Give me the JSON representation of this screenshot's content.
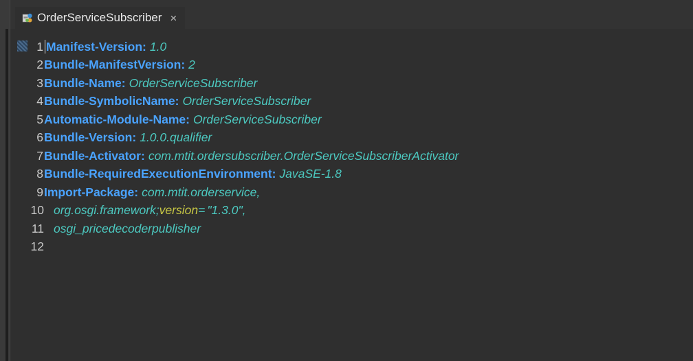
{
  "tab": {
    "title": "OrderServiceSubscriber",
    "close_glyph": "×",
    "icon": "manifest-file-icon"
  },
  "editor": {
    "lines": [
      {
        "num": "1",
        "key": "Manifest-Version",
        "value": "1.0"
      },
      {
        "num": "2",
        "key": "Bundle-ManifestVersion",
        "value": "2"
      },
      {
        "num": "3",
        "key": "Bundle-Name",
        "value": "OrderServiceSubscriber"
      },
      {
        "num": "4",
        "key": "Bundle-SymbolicName",
        "value": "OrderServiceSubscriber"
      },
      {
        "num": "5",
        "key": "Automatic-Module-Name",
        "value": "OrderServiceSubscriber"
      },
      {
        "num": "6",
        "key": "Bundle-Version",
        "value": "1.0.0.qualifier"
      },
      {
        "num": "7",
        "key": "Bundle-Activator",
        "value": "com.mtit.ordersubscriber.OrderServiceSubscriberActivator"
      },
      {
        "num": "8",
        "key": "Bundle-RequiredExecutionEnvironment",
        "value": "JavaSE-1.8"
      },
      {
        "num": "9",
        "key": "Import-Package",
        "value": "com.mtit.orderservice,"
      },
      {
        "num": "10",
        "pkg": "org.osgi.framework;",
        "attr": "version",
        "eq": "=",
        "str": "\"1.3.0\","
      },
      {
        "num": "11",
        "text": "osgi_pricedecoderpublisher"
      },
      {
        "num": "12"
      }
    ]
  },
  "colors": {
    "background": "#2f2f2f",
    "key": "#4aa3ff",
    "value": "#4cc9c0",
    "attribute": "#c6c644",
    "line_number": "#c8c8c8"
  }
}
